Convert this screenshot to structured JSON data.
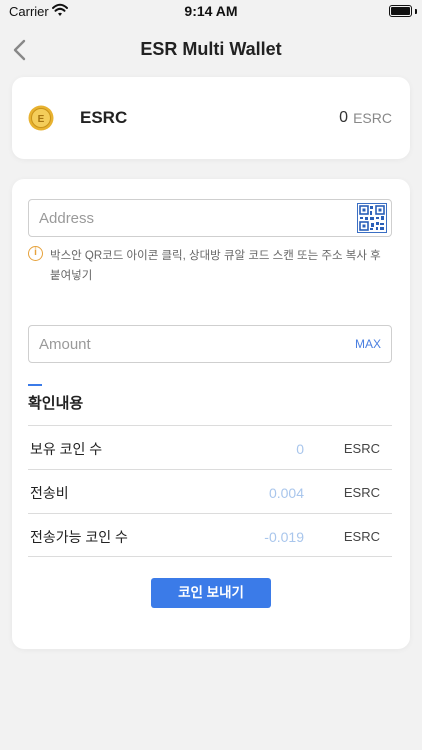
{
  "status_bar": {
    "carrier": "Carrier",
    "time": "9:14 AM"
  },
  "header": {
    "title": "ESR Multi Wallet"
  },
  "balance": {
    "coin_name": "ESRC",
    "amount": "0",
    "unit": "ESRC",
    "icon_color": "#e8b230"
  },
  "form": {
    "address_placeholder": "Address",
    "hint": "박스안 QR코드 아이콘 클릭, 상대방 큐알 코드 스캔 또는 주소 복사 후 붙여넣기",
    "amount_placeholder": "Amount",
    "max_label": "MAX"
  },
  "confirm": {
    "title": "확인내용",
    "rows": [
      {
        "label": "보유 코인 수",
        "value": "0",
        "unit": "ESRC"
      },
      {
        "label": "전송비",
        "value": "0.004",
        "unit": "ESRC"
      },
      {
        "label": "전송가능 코인 수",
        "value": "-0.019",
        "unit": "ESRC"
      }
    ]
  },
  "send_button": "코인 보내기",
  "colors": {
    "accent": "#3b7be8",
    "warning": "#e6a23c",
    "value_text": "#a9c6ec"
  }
}
